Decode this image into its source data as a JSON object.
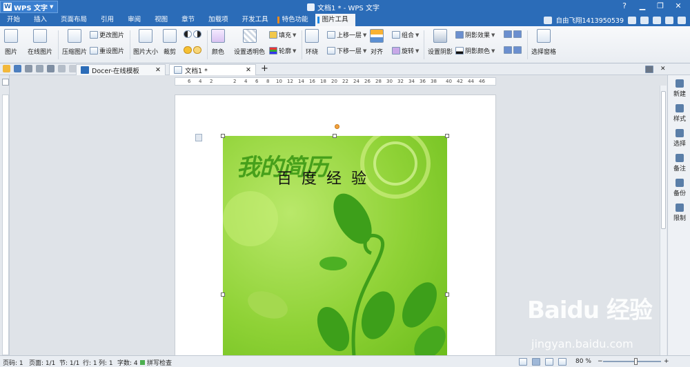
{
  "title_bar": {
    "app_button": "WPS 文字",
    "doc_title": "文档1 * - WPS 文字",
    "window_controls": [
      "?",
      "▁",
      "❐",
      "✕"
    ]
  },
  "menu_tabs": [
    "开始",
    "插入",
    "页面布局",
    "引用",
    "审阅",
    "视图",
    "章节",
    "加载项",
    "开发工具",
    "特色功能",
    "图片工具"
  ],
  "selected_tab": "图片工具",
  "user": {
    "name": "自由飞翔1413950539"
  },
  "ribbon": {
    "picture": "图片",
    "online_picture": "在线图片",
    "compress": "压缩图片",
    "change_picture": "更改图片",
    "reset_picture": "重设图片",
    "picture_size": "图片大小",
    "crop": "裁剪",
    "color": "颜色",
    "set_transparent": "设置透明色",
    "fill": "填充",
    "outline": "轮廓",
    "wrap": "环绕",
    "bring_forward": "上移一层",
    "send_backward": "下移一层",
    "align": "对齐",
    "group": "组合",
    "rotate": "旋转",
    "set_shadow": "设置阴影",
    "shadow_effect": "阴影效果",
    "shadow_color": "阴影颜色",
    "selection_pane": "选择窗格"
  },
  "doc_tabs": [
    {
      "label": "Docer-在线模板"
    },
    {
      "label": "文档1 *"
    }
  ],
  "ruler_ticks": [
    "6",
    "4",
    "2",
    "2",
    "4",
    "6",
    "8",
    "10",
    "12",
    "14",
    "16",
    "18",
    "20",
    "22",
    "24",
    "26",
    "28",
    "30",
    "32",
    "34",
    "36",
    "38",
    "40",
    "42",
    "44",
    "46"
  ],
  "image": {
    "watermark": "我的简历",
    "caption": "百度经验"
  },
  "side_panel": [
    "新建",
    "样式",
    "选择",
    "备注",
    "备份",
    "限制"
  ],
  "status": {
    "page_num": "页码: 1",
    "pages": "页面: 1/1",
    "section": "节: 1/1",
    "row": "行: 1",
    "col": "列: 1",
    "chars": "字数: 4",
    "spell": "拼写检查",
    "zoom": "80 %"
  },
  "watermark_site": {
    "brand": "Baidu 经验",
    "url": "jingyan.baidu.com"
  },
  "colors": {
    "accent": "#2b6cb8",
    "tab_mark_orange": "#f08a1c",
    "tab_mark_blue": "#1e88e5"
  }
}
